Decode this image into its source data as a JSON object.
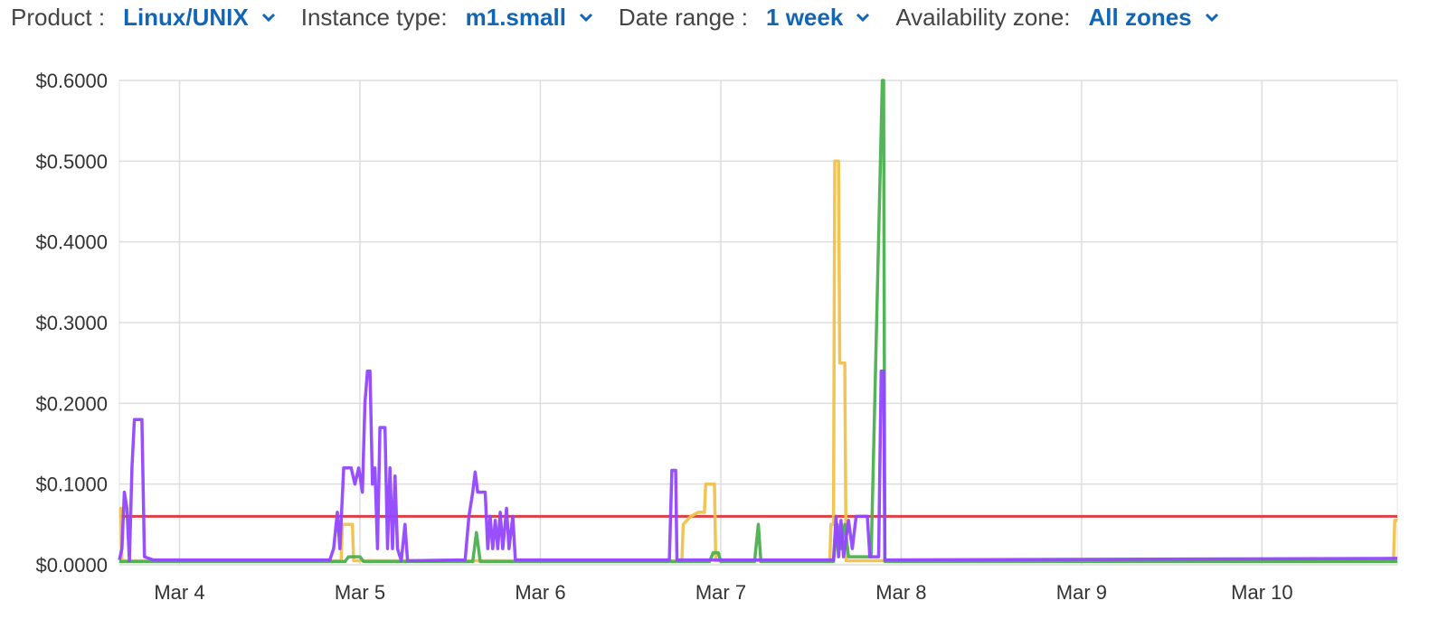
{
  "filters": [
    {
      "label": "Product :",
      "value": "Linux/UNIX",
      "icon": "chevron-down-icon"
    },
    {
      "label": "Instance type:",
      "value": "m1.small",
      "icon": "chevron-down-icon"
    },
    {
      "label": "Date range :",
      "value": "1 week",
      "icon": "chevron-down-icon"
    },
    {
      "label": "Availability zone:",
      "value": "All zones",
      "icon": "chevron-down-icon"
    }
  ],
  "colors": {
    "accent": "#1266b5",
    "text": "#333333",
    "grid": "#dddddd",
    "series_orange": "#f0c24a",
    "series_green": "#4caf50",
    "series_purple": "#9146ff",
    "series_red": "#d9373a"
  },
  "chart_data": {
    "type": "line",
    "xlabel": "",
    "ylabel": "",
    "x_range": [
      "2014-03-03 16:00",
      "2014-03-10 18:00"
    ],
    "ylim": [
      0,
      0.6
    ],
    "y_ticks": [
      "$0.0000",
      "$0.1000",
      "$0.2000",
      "$0.3000",
      "$0.4000",
      "$0.5000",
      "$0.6000"
    ],
    "y_tick_values": [
      0,
      0.1,
      0.2,
      0.3,
      0.4,
      0.5,
      0.6
    ],
    "x_ticks": [
      "Mar 4",
      "Mar 5",
      "Mar 6",
      "Mar 7",
      "Mar 8",
      "Mar 9",
      "Mar 10"
    ],
    "x_tick_values": [
      "2014-03-04 00:00",
      "2014-03-05 00:00",
      "2014-03-06 00:00",
      "2014-03-07 00:00",
      "2014-03-08 00:00",
      "2014-03-09 00:00",
      "2014-03-10 00:00"
    ],
    "grid": true,
    "legend": "none",
    "series": [
      {
        "color": "#d9373a",
        "points": [
          [
            "2014-03-03 16:00",
            0.06
          ],
          [
            "2014-03-10 18:00",
            0.06
          ]
        ]
      },
      {
        "color": "#f0c24a",
        "points": [
          [
            "2014-03-03 16:00",
            0.07
          ],
          [
            "2014-03-03 16:10",
            0.07
          ],
          [
            "2014-03-03 16:20",
            0.005
          ],
          [
            "2014-03-04 21:30",
            0.005
          ],
          [
            "2014-03-04 21:40",
            0.05
          ],
          [
            "2014-03-04 23:00",
            0.05
          ],
          [
            "2014-03-04 23:10",
            0.005
          ],
          [
            "2014-03-06 18:50",
            0.005
          ],
          [
            "2014-03-06 19:00",
            0.05
          ],
          [
            "2014-03-06 20:00",
            0.06
          ],
          [
            "2014-03-06 21:00",
            0.065
          ],
          [
            "2014-03-06 21:50",
            0.065
          ],
          [
            "2014-03-06 22:00",
            0.1
          ],
          [
            "2014-03-06 23:10",
            0.1
          ],
          [
            "2014-03-06 23:20",
            0.005
          ],
          [
            "2014-03-07 14:30",
            0.005
          ],
          [
            "2014-03-07 14:40",
            0.05
          ],
          [
            "2014-03-07 15:00",
            0.05
          ],
          [
            "2014-03-07 15:10",
            0.5
          ],
          [
            "2014-03-07 15:40",
            0.5
          ],
          [
            "2014-03-07 15:50",
            0.25
          ],
          [
            "2014-03-07 16:30",
            0.25
          ],
          [
            "2014-03-07 16:40",
            0.005
          ],
          [
            "2014-03-10 17:30",
            0.005
          ],
          [
            "2014-03-10 17:40",
            0.055
          ],
          [
            "2014-03-10 18:00",
            0.055
          ]
        ]
      },
      {
        "color": "#4caf50",
        "points": [
          [
            "2014-03-03 16:00",
            0.004
          ],
          [
            "2014-03-04 22:00",
            0.004
          ],
          [
            "2014-03-04 22:30",
            0.01
          ],
          [
            "2014-03-05 00:00",
            0.01
          ],
          [
            "2014-03-05 00:30",
            0.004
          ],
          [
            "2014-03-05 15:00",
            0.004
          ],
          [
            "2014-03-05 15:30",
            0.04
          ],
          [
            "2014-03-05 16:00",
            0.004
          ],
          [
            "2014-03-06 22:30",
            0.004
          ],
          [
            "2014-03-06 23:00",
            0.015
          ],
          [
            "2014-03-06 23:40",
            0.015
          ],
          [
            "2014-03-07 00:00",
            0.004
          ],
          [
            "2014-03-07 04:30",
            0.004
          ],
          [
            "2014-03-07 05:00",
            0.05
          ],
          [
            "2014-03-07 05:20",
            0.004
          ],
          [
            "2014-03-07 15:00",
            0.004
          ],
          [
            "2014-03-07 15:30",
            0.05
          ],
          [
            "2014-03-07 16:00",
            0.02
          ],
          [
            "2014-03-07 16:30",
            0.05
          ],
          [
            "2014-03-07 17:00",
            0.01
          ],
          [
            "2014-03-07 20:00",
            0.01
          ],
          [
            "2014-03-07 21:30",
            0.6
          ],
          [
            "2014-03-07 21:40",
            0.6
          ],
          [
            "2014-03-07 21:50",
            0.004
          ],
          [
            "2014-03-10 18:00",
            0.004
          ]
        ]
      },
      {
        "color": "#9146ff",
        "points": [
          [
            "2014-03-03 16:00",
            0.006
          ],
          [
            "2014-03-03 16:20",
            0.02
          ],
          [
            "2014-03-03 16:40",
            0.09
          ],
          [
            "2014-03-03 17:00",
            0.07
          ],
          [
            "2014-03-03 17:20",
            0.005
          ],
          [
            "2014-03-03 17:40",
            0.12
          ],
          [
            "2014-03-03 18:00",
            0.18
          ],
          [
            "2014-03-03 19:00",
            0.18
          ],
          [
            "2014-03-03 19:20",
            0.01
          ],
          [
            "2014-03-03 20:30",
            0.006
          ],
          [
            "2014-03-04 20:00",
            0.006
          ],
          [
            "2014-03-04 20:30",
            0.02
          ],
          [
            "2014-03-04 21:00",
            0.065
          ],
          [
            "2014-03-04 21:20",
            0.02
          ],
          [
            "2014-03-04 21:50",
            0.12
          ],
          [
            "2014-03-04 22:50",
            0.12
          ],
          [
            "2014-03-04 23:20",
            0.1
          ],
          [
            "2014-03-04 23:50",
            0.12
          ],
          [
            "2014-03-05 00:20",
            0.09
          ],
          [
            "2014-03-05 00:40",
            0.2
          ],
          [
            "2014-03-05 01:00",
            0.24
          ],
          [
            "2014-03-05 01:20",
            0.24
          ],
          [
            "2014-03-05 01:40",
            0.1
          ],
          [
            "2014-03-05 02:00",
            0.12
          ],
          [
            "2014-03-05 02:20",
            0.02
          ],
          [
            "2014-03-05 02:40",
            0.17
          ],
          [
            "2014-03-05 03:20",
            0.17
          ],
          [
            "2014-03-05 03:40",
            0.02
          ],
          [
            "2014-03-05 04:00",
            0.12
          ],
          [
            "2014-03-05 04:20",
            0.02
          ],
          [
            "2014-03-05 04:40",
            0.11
          ],
          [
            "2014-03-05 05:00",
            0.02
          ],
          [
            "2014-03-05 05:30",
            0.005
          ],
          [
            "2014-03-05 06:00",
            0.05
          ],
          [
            "2014-03-05 06:20",
            0.005
          ],
          [
            "2014-03-05 14:00",
            0.006
          ],
          [
            "2014-03-05 14:30",
            0.06
          ],
          [
            "2014-03-05 15:00",
            0.09
          ],
          [
            "2014-03-05 15:20",
            0.115
          ],
          [
            "2014-03-05 15:40",
            0.09
          ],
          [
            "2014-03-05 16:40",
            0.09
          ],
          [
            "2014-03-05 17:00",
            0.02
          ],
          [
            "2014-03-05 17:20",
            0.06
          ],
          [
            "2014-03-05 17:40",
            0.02
          ],
          [
            "2014-03-05 18:00",
            0.055
          ],
          [
            "2014-03-05 18:20",
            0.02
          ],
          [
            "2014-03-05 18:40",
            0.065
          ],
          [
            "2014-03-05 19:00",
            0.02
          ],
          [
            "2014-03-05 19:30",
            0.07
          ],
          [
            "2014-03-05 19:50",
            0.02
          ],
          [
            "2014-03-05 20:20",
            0.06
          ],
          [
            "2014-03-05 20:40",
            0.006
          ],
          [
            "2014-03-06 17:10",
            0.006
          ],
          [
            "2014-03-06 17:30",
            0.117
          ],
          [
            "2014-03-06 18:00",
            0.117
          ],
          [
            "2014-03-06 18:10",
            0.006
          ],
          [
            "2014-03-07 15:00",
            0.006
          ],
          [
            "2014-03-07 15:20",
            0.06
          ],
          [
            "2014-03-07 15:40",
            0.01
          ],
          [
            "2014-03-07 16:00",
            0.055
          ],
          [
            "2014-03-07 16:20",
            0.01
          ],
          [
            "2014-03-07 17:00",
            0.055
          ],
          [
            "2014-03-07 17:30",
            0.02
          ],
          [
            "2014-03-07 18:00",
            0.06
          ],
          [
            "2014-03-07 19:30",
            0.06
          ],
          [
            "2014-03-07 19:50",
            0.01
          ],
          [
            "2014-03-07 21:00",
            0.01
          ],
          [
            "2014-03-07 21:20",
            0.24
          ],
          [
            "2014-03-07 21:40",
            0.24
          ],
          [
            "2014-03-07 21:50",
            0.006
          ],
          [
            "2014-03-10 18:00",
            0.008
          ]
        ]
      }
    ]
  }
}
